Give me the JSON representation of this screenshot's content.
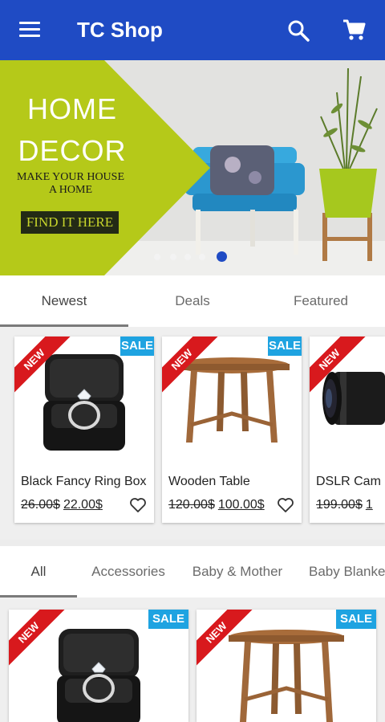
{
  "app_bar": {
    "title": "TC Shop",
    "menu_icon": "menu-icon",
    "search_icon": "search-icon",
    "cart_icon": "cart-icon",
    "background_color": "#1f4bc4"
  },
  "banner": {
    "headline_line1": "HOME",
    "headline_line2": "DECOR",
    "subtitle_line1": "MAKE YOUR HOUSE",
    "subtitle_line2": "A HOME",
    "cta_label": "FIND IT HERE",
    "slide_count": 5,
    "active_slide": 5,
    "accent_color": "#b5c919"
  },
  "featured_tabs": {
    "items": [
      "Newest",
      "Deals",
      "Featured"
    ],
    "active": "Newest"
  },
  "featured_products": [
    {
      "badge_new": "NEW",
      "badge_sale": "SALE",
      "name": "Black Fancy Ring Box",
      "old_price": "26.00$",
      "new_price": "22.00$"
    },
    {
      "badge_new": "NEW",
      "badge_sale": "SALE",
      "name": "Wooden Table",
      "old_price": "120.00$",
      "new_price": "100.00$"
    },
    {
      "badge_new": "NEW",
      "badge_sale": "",
      "name": "DSLR Cam",
      "old_price": "199.00$",
      "new_price": "1"
    }
  ],
  "category_tabs": {
    "items": [
      "All",
      "Accessories",
      "Baby & Mother",
      "Baby Blanke"
    ],
    "active": "All"
  },
  "grid_products": [
    {
      "badge_new": "NEW",
      "badge_sale": "SALE"
    },
    {
      "badge_new": "NEW",
      "badge_sale": "SALE"
    }
  ]
}
